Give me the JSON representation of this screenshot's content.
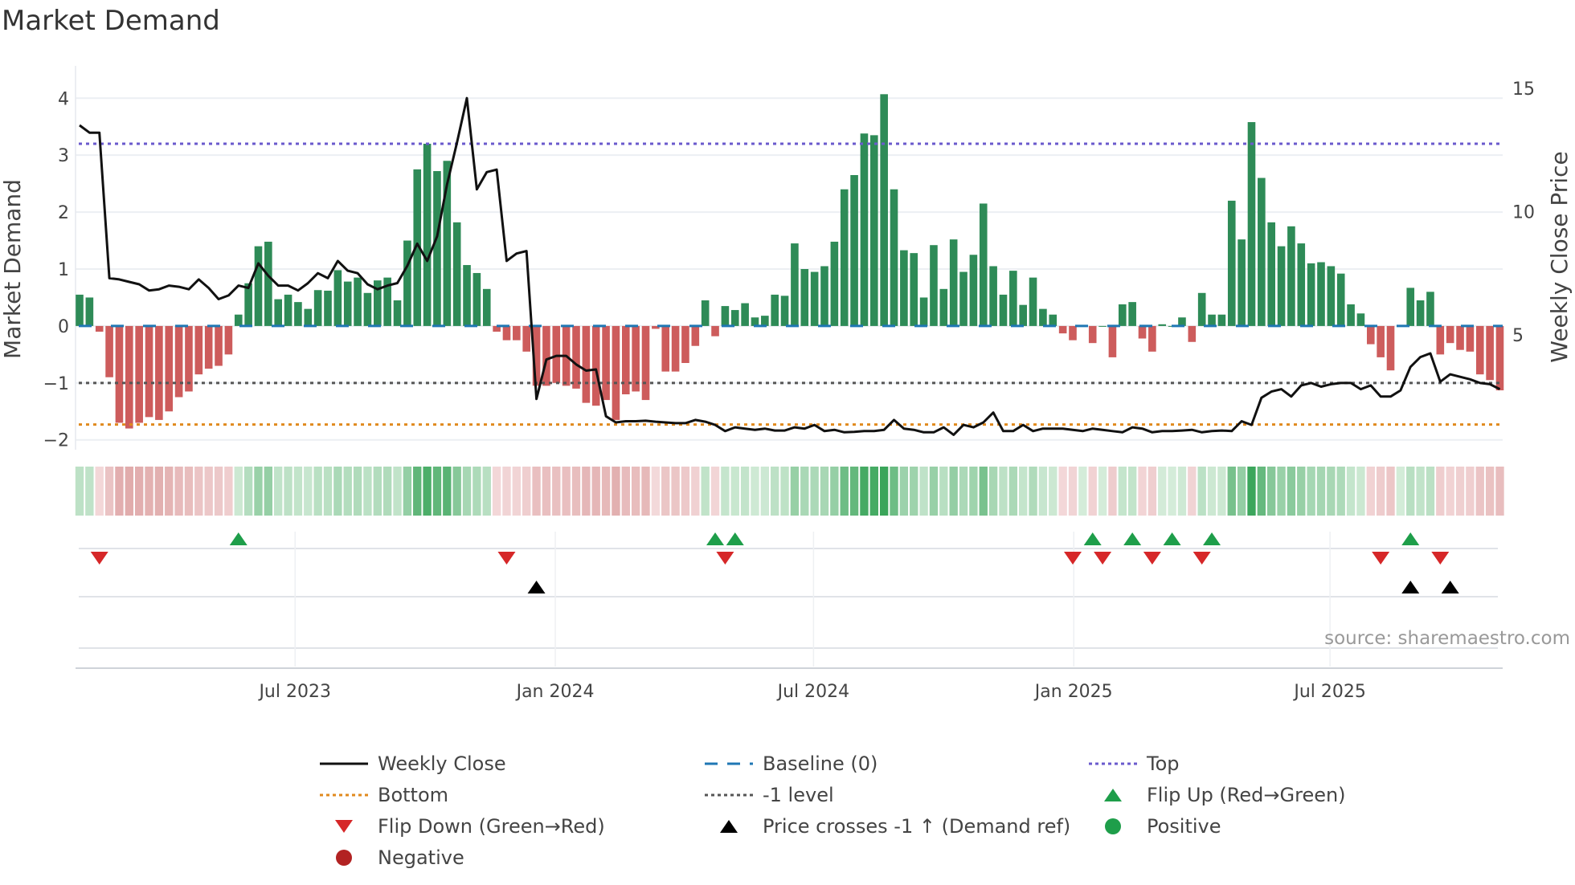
{
  "title": "Market Demand",
  "source": "source: sharemaestro.com",
  "legend": [
    {
      "label": "Weekly Close",
      "symbol": "line",
      "color": "#111111"
    },
    {
      "label": "Baseline (0)",
      "symbol": "dash",
      "color": "#1f77b4"
    },
    {
      "label": "Top",
      "symbol": "dot",
      "color": "#6a5acd"
    },
    {
      "label": "Bottom",
      "symbol": "dot",
      "color": "#e08a1e"
    },
    {
      "label": "-1 level",
      "symbol": "dot",
      "color": "#555555"
    },
    {
      "label": "Flip Up (Red→Green)",
      "symbol": "tri-up",
      "color": "#1e9e4a"
    },
    {
      "label": "Flip Down (Green→Red)",
      "symbol": "tri-down",
      "color": "#d62728"
    },
    {
      "label": "Price crosses -1 ↑ (Demand ref)",
      "symbol": "tri-up",
      "color": "#000000"
    },
    {
      "label": "Positive",
      "symbol": "circle",
      "color": "#1e9e4a"
    },
    {
      "label": "Negative",
      "symbol": "circle",
      "color": "#b22222"
    }
  ],
  "chart_data": {
    "type": "bar",
    "title": "Market Demand",
    "ylabel": "Market Demand",
    "y2label": "Weekly Close Price",
    "ylim": [
      -2.3,
      4.3
    ],
    "y2lim": [
      0.05,
      15.29
    ],
    "yticks": [
      "4",
      "3",
      "2",
      "1",
      "0",
      "−1",
      "−2"
    ],
    "yticks_values": [
      4,
      3,
      2,
      1,
      0,
      -1,
      -2
    ],
    "y2ticks": [
      "15",
      "10",
      "5"
    ],
    "y2ticks_values": [
      15,
      10,
      5
    ],
    "xticks": [
      {
        "label": "Jul 2023",
        "week": 21.7
      },
      {
        "label": "Jan 2024",
        "week": 47.9
      },
      {
        "label": "Jul 2024",
        "week": 73.9
      },
      {
        "label": "Jan 2025",
        "week": 100.1
      },
      {
        "label": "Jul 2025",
        "week": 125.9
      }
    ],
    "levels": {
      "baseline": 0,
      "top": 3.2,
      "bottom": -1.73,
      "minus_one": -1
    },
    "colors": {
      "positive": "#2e8b57",
      "negative": "#cd5c5c"
    },
    "demand": [
      0.55,
      0.5,
      -0.1,
      -0.9,
      -1.7,
      -1.8,
      -1.7,
      -1.6,
      -1.65,
      -1.5,
      -1.25,
      -1.15,
      -0.85,
      -0.75,
      -0.7,
      -0.5,
      0.2,
      0.75,
      1.4,
      1.48,
      0.47,
      0.55,
      0.42,
      0.3,
      0.63,
      0.62,
      0.98,
      0.78,
      0.85,
      0.58,
      0.8,
      0.85,
      0.45,
      1.5,
      2.75,
      3.2,
      2.72,
      2.9,
      1.82,
      1.07,
      0.93,
      0.65,
      -0.1,
      -0.25,
      -0.25,
      -0.45,
      -1.05,
      -1.05,
      -1.0,
      -1.05,
      -1.1,
      -1.35,
      -1.4,
      -1.3,
      -1.65,
      -1.2,
      -1.15,
      -1.3,
      -0.05,
      -0.8,
      -0.8,
      -0.65,
      -0.35,
      0.45,
      -0.18,
      0.35,
      0.28,
      0.4,
      0.15,
      0.18,
      0.55,
      0.53,
      1.45,
      1.0,
      0.95,
      1.05,
      1.48,
      2.4,
      2.65,
      3.38,
      3.35,
      4.07,
      2.4,
      1.33,
      1.28,
      0.5,
      1.42,
      0.65,
      1.52,
      0.95,
      1.25,
      2.15,
      1.05,
      0.55,
      0.97,
      0.37,
      0.85,
      0.3,
      0.2,
      -0.13,
      -0.25,
      0.0,
      -0.3,
      0.0,
      -0.55,
      0.38,
      0.42,
      -0.22,
      -0.45,
      0.03,
      0.0,
      0.15,
      -0.28,
      0.58,
      0.2,
      0.2,
      2.2,
      1.52,
      3.58,
      2.6,
      1.82,
      1.4,
      1.75,
      1.45,
      1.1,
      1.12,
      1.05,
      0.92,
      0.38,
      0.22,
      -0.32,
      -0.55,
      -0.78,
      0.02,
      0.67,
      0.45,
      0.6,
      -0.5,
      -0.3,
      -0.42,
      -0.45,
      -0.85,
      -0.95,
      -1.13
    ],
    "weekly_close": [
      13.5,
      13.2,
      13.2,
      7.3,
      7.25,
      7.15,
      7.05,
      6.8,
      6.85,
      7.0,
      6.95,
      6.85,
      7.25,
      6.9,
      6.45,
      6.6,
      7.0,
      6.9,
      7.9,
      7.4,
      7.0,
      7.0,
      6.8,
      7.1,
      7.5,
      7.3,
      8.0,
      7.6,
      7.5,
      7.05,
      6.85,
      7.0,
      7.1,
      7.8,
      8.7,
      8.0,
      9.0,
      11.1,
      12.8,
      14.6,
      10.9,
      11.6,
      11.7,
      8.0,
      8.3,
      8.4,
      2.4,
      4.0,
      4.15,
      4.15,
      3.8,
      3.55,
      3.6,
      1.7,
      1.45,
      1.5,
      1.5,
      1.52,
      1.48,
      1.45,
      1.42,
      1.42,
      1.55,
      1.48,
      1.35,
      1.1,
      1.25,
      1.2,
      1.15,
      1.2,
      1.12,
      1.12,
      1.25,
      1.2,
      1.35,
      1.1,
      1.15,
      1.05,
      1.07,
      1.1,
      1.1,
      1.15,
      1.55,
      1.2,
      1.15,
      1.05,
      1.05,
      1.25,
      0.95,
      1.35,
      1.25,
      1.45,
      1.85,
      1.1,
      1.1,
      1.35,
      1.1,
      1.2,
      1.2,
      1.2,
      1.15,
      1.1,
      1.2,
      1.15,
      1.1,
      1.05,
      1.25,
      1.2,
      1.05,
      1.1,
      1.1,
      1.12,
      1.15,
      1.05,
      1.1,
      1.12,
      1.1,
      1.5,
      1.35,
      2.45,
      2.7,
      2.8,
      2.5,
      2.95,
      3.05,
      2.9,
      3.0,
      3.05,
      3.05,
      2.8,
      2.95,
      2.5,
      2.5,
      2.75,
      3.7,
      4.1,
      4.25,
      3.1,
      3.4,
      3.3,
      3.2,
      3.05,
      3.0,
      2.8
    ],
    "flip_up_weeks": [
      16,
      64,
      66,
      102,
      106,
      110,
      114,
      134
    ],
    "flip_down_weeks": [
      2,
      43,
      65,
      100,
      103,
      108,
      113,
      131,
      137
    ],
    "price_cross_weeks": [
      46,
      134,
      138
    ]
  }
}
